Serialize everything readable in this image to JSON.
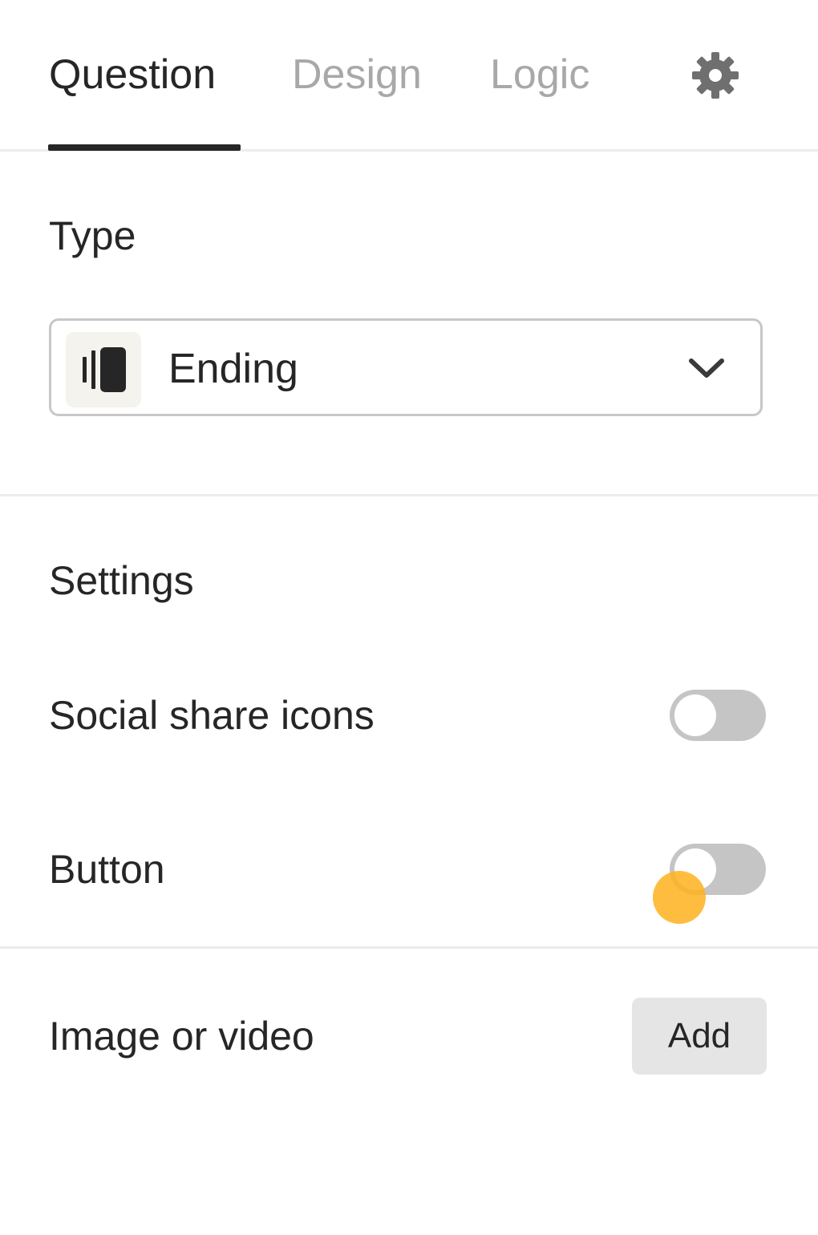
{
  "tabs": [
    {
      "label": "Question",
      "active": true
    },
    {
      "label": "Design",
      "active": false
    },
    {
      "label": "Logic",
      "active": false
    }
  ],
  "settings_icon": "gear-icon",
  "type_section": {
    "title": "Type",
    "selected": "Ending",
    "selected_icon": "ending-icon",
    "dropdown_icon": "chevron-down-icon"
  },
  "settings_section": {
    "title": "Settings",
    "options": [
      {
        "label": "Social share icons",
        "enabled": false
      },
      {
        "label": "Button",
        "enabled": false
      }
    ]
  },
  "media": {
    "label": "Image or video",
    "add_label": "Add"
  },
  "colors": {
    "text": "#262627",
    "inactive_tab": "#a8a8a8",
    "toggle_off": "#c5c5c5",
    "cursor_indicator": "#ffb21e"
  }
}
